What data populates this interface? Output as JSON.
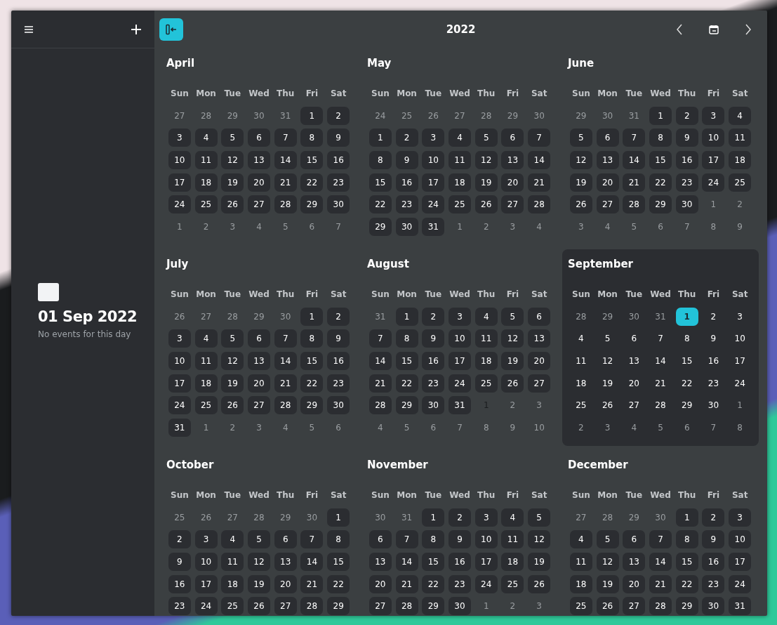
{
  "sidebar": {
    "date": "01 Sep 2022",
    "caption": "No events for this day"
  },
  "header": {
    "title": "2022"
  },
  "months": [
    {
      "name": "April",
      "current": false,
      "weekdays": [
        "Sun",
        "Mon",
        "Tue",
        "Wed",
        "Thu",
        "Fri",
        "Sat"
      ],
      "weeks": [
        [
          {
            "n": "27",
            "in": false,
            "selected": false
          },
          {
            "n": "28",
            "in": false,
            "selected": false
          },
          {
            "n": "29",
            "in": false,
            "selected": false
          },
          {
            "n": "30",
            "in": false,
            "selected": false
          },
          {
            "n": "31",
            "in": false,
            "selected": false
          },
          {
            "n": "1",
            "in": true,
            "selected": false
          },
          {
            "n": "2",
            "in": true,
            "selected": false
          }
        ],
        [
          {
            "n": "3",
            "in": true,
            "selected": false
          },
          {
            "n": "4",
            "in": true,
            "selected": false
          },
          {
            "n": "5",
            "in": true,
            "selected": false
          },
          {
            "n": "6",
            "in": true,
            "selected": false
          },
          {
            "n": "7",
            "in": true,
            "selected": false
          },
          {
            "n": "8",
            "in": true,
            "selected": false
          },
          {
            "n": "9",
            "in": true,
            "selected": false
          }
        ],
        [
          {
            "n": "10",
            "in": true,
            "selected": false
          },
          {
            "n": "11",
            "in": true,
            "selected": false
          },
          {
            "n": "12",
            "in": true,
            "selected": false
          },
          {
            "n": "13",
            "in": true,
            "selected": false
          },
          {
            "n": "14",
            "in": true,
            "selected": false
          },
          {
            "n": "15",
            "in": true,
            "selected": false
          },
          {
            "n": "16",
            "in": true,
            "selected": false
          }
        ],
        [
          {
            "n": "17",
            "in": true,
            "selected": false
          },
          {
            "n": "18",
            "in": true,
            "selected": false
          },
          {
            "n": "19",
            "in": true,
            "selected": false
          },
          {
            "n": "20",
            "in": true,
            "selected": false
          },
          {
            "n": "21",
            "in": true,
            "selected": false
          },
          {
            "n": "22",
            "in": true,
            "selected": false
          },
          {
            "n": "23",
            "in": true,
            "selected": false
          }
        ],
        [
          {
            "n": "24",
            "in": true,
            "selected": false
          },
          {
            "n": "25",
            "in": true,
            "selected": false
          },
          {
            "n": "26",
            "in": true,
            "selected": false
          },
          {
            "n": "27",
            "in": true,
            "selected": false
          },
          {
            "n": "28",
            "in": true,
            "selected": false
          },
          {
            "n": "29",
            "in": true,
            "selected": false
          },
          {
            "n": "30",
            "in": true,
            "selected": false
          }
        ],
        [
          {
            "n": "1",
            "in": false,
            "selected": false
          },
          {
            "n": "2",
            "in": false,
            "selected": false
          },
          {
            "n": "3",
            "in": false,
            "selected": false
          },
          {
            "n": "4",
            "in": false,
            "selected": false
          },
          {
            "n": "5",
            "in": false,
            "selected": false
          },
          {
            "n": "6",
            "in": false,
            "selected": false
          },
          {
            "n": "7",
            "in": false,
            "selected": false
          }
        ]
      ]
    },
    {
      "name": "May",
      "current": false,
      "weekdays": [
        "Sun",
        "Mon",
        "Tue",
        "Wed",
        "Thu",
        "Fri",
        "Sat"
      ],
      "weeks": [
        [
          {
            "n": "24",
            "in": false,
            "selected": false
          },
          {
            "n": "25",
            "in": false,
            "selected": false
          },
          {
            "n": "26",
            "in": false,
            "selected": false
          },
          {
            "n": "27",
            "in": false,
            "selected": false
          },
          {
            "n": "28",
            "in": false,
            "selected": false
          },
          {
            "n": "29",
            "in": false,
            "selected": false
          },
          {
            "n": "30",
            "in": false,
            "selected": false
          }
        ],
        [
          {
            "n": "1",
            "in": true,
            "selected": false
          },
          {
            "n": "2",
            "in": true,
            "selected": false
          },
          {
            "n": "3",
            "in": true,
            "selected": false
          },
          {
            "n": "4",
            "in": true,
            "selected": false
          },
          {
            "n": "5",
            "in": true,
            "selected": false
          },
          {
            "n": "6",
            "in": true,
            "selected": false
          },
          {
            "n": "7",
            "in": true,
            "selected": false
          }
        ],
        [
          {
            "n": "8",
            "in": true,
            "selected": false
          },
          {
            "n": "9",
            "in": true,
            "selected": false
          },
          {
            "n": "10",
            "in": true,
            "selected": false
          },
          {
            "n": "11",
            "in": true,
            "selected": false
          },
          {
            "n": "12",
            "in": true,
            "selected": false
          },
          {
            "n": "13",
            "in": true,
            "selected": false
          },
          {
            "n": "14",
            "in": true,
            "selected": false
          }
        ],
        [
          {
            "n": "15",
            "in": true,
            "selected": false
          },
          {
            "n": "16",
            "in": true,
            "selected": false
          },
          {
            "n": "17",
            "in": true,
            "selected": false
          },
          {
            "n": "18",
            "in": true,
            "selected": false
          },
          {
            "n": "19",
            "in": true,
            "selected": false
          },
          {
            "n": "20",
            "in": true,
            "selected": false
          },
          {
            "n": "21",
            "in": true,
            "selected": false
          }
        ],
        [
          {
            "n": "22",
            "in": true,
            "selected": false
          },
          {
            "n": "23",
            "in": true,
            "selected": false
          },
          {
            "n": "24",
            "in": true,
            "selected": false
          },
          {
            "n": "25",
            "in": true,
            "selected": false
          },
          {
            "n": "26",
            "in": true,
            "selected": false
          },
          {
            "n": "27",
            "in": true,
            "selected": false
          },
          {
            "n": "28",
            "in": true,
            "selected": false
          }
        ],
        [
          {
            "n": "29",
            "in": true,
            "selected": false
          },
          {
            "n": "30",
            "in": true,
            "selected": false
          },
          {
            "n": "31",
            "in": true,
            "selected": false
          },
          {
            "n": "1",
            "in": false,
            "selected": false
          },
          {
            "n": "2",
            "in": false,
            "selected": false
          },
          {
            "n": "3",
            "in": false,
            "selected": false
          },
          {
            "n": "4",
            "in": false,
            "selected": false
          }
        ]
      ]
    },
    {
      "name": "June",
      "current": false,
      "weekdays": [
        "Sun",
        "Mon",
        "Tue",
        "Wed",
        "Thu",
        "Fri",
        "Sat"
      ],
      "weeks": [
        [
          {
            "n": "29",
            "in": false,
            "selected": false
          },
          {
            "n": "30",
            "in": false,
            "selected": false
          },
          {
            "n": "31",
            "in": false,
            "selected": false
          },
          {
            "n": "1",
            "in": true,
            "selected": false
          },
          {
            "n": "2",
            "in": true,
            "selected": false
          },
          {
            "n": "3",
            "in": true,
            "selected": false
          },
          {
            "n": "4",
            "in": true,
            "selected": false
          }
        ],
        [
          {
            "n": "5",
            "in": true,
            "selected": false
          },
          {
            "n": "6",
            "in": true,
            "selected": false
          },
          {
            "n": "7",
            "in": true,
            "selected": false
          },
          {
            "n": "8",
            "in": true,
            "selected": false
          },
          {
            "n": "9",
            "in": true,
            "selected": false
          },
          {
            "n": "10",
            "in": true,
            "selected": false
          },
          {
            "n": "11",
            "in": true,
            "selected": false
          }
        ],
        [
          {
            "n": "12",
            "in": true,
            "selected": false
          },
          {
            "n": "13",
            "in": true,
            "selected": false
          },
          {
            "n": "14",
            "in": true,
            "selected": false
          },
          {
            "n": "15",
            "in": true,
            "selected": false
          },
          {
            "n": "16",
            "in": true,
            "selected": false
          },
          {
            "n": "17",
            "in": true,
            "selected": false
          },
          {
            "n": "18",
            "in": true,
            "selected": false
          }
        ],
        [
          {
            "n": "19",
            "in": true,
            "selected": false
          },
          {
            "n": "20",
            "in": true,
            "selected": false
          },
          {
            "n": "21",
            "in": true,
            "selected": false
          },
          {
            "n": "22",
            "in": true,
            "selected": false
          },
          {
            "n": "23",
            "in": true,
            "selected": false
          },
          {
            "n": "24",
            "in": true,
            "selected": false
          },
          {
            "n": "25",
            "in": true,
            "selected": false
          }
        ],
        [
          {
            "n": "26",
            "in": true,
            "selected": false
          },
          {
            "n": "27",
            "in": true,
            "selected": false
          },
          {
            "n": "28",
            "in": true,
            "selected": false
          },
          {
            "n": "29",
            "in": true,
            "selected": false
          },
          {
            "n": "30",
            "in": true,
            "selected": false
          },
          {
            "n": "1",
            "in": false,
            "selected": false
          },
          {
            "n": "2",
            "in": false,
            "selected": false
          }
        ],
        [
          {
            "n": "3",
            "in": false,
            "selected": false
          },
          {
            "n": "4",
            "in": false,
            "selected": false
          },
          {
            "n": "5",
            "in": false,
            "selected": false
          },
          {
            "n": "6",
            "in": false,
            "selected": false
          },
          {
            "n": "7",
            "in": false,
            "selected": false
          },
          {
            "n": "8",
            "in": false,
            "selected": false
          },
          {
            "n": "9",
            "in": false,
            "selected": false
          }
        ]
      ]
    },
    {
      "name": "July",
      "current": false,
      "weekdays": [
        "Sun",
        "Mon",
        "Tue",
        "Wed",
        "Thu",
        "Fri",
        "Sat"
      ],
      "weeks": [
        [
          {
            "n": "26",
            "in": false,
            "selected": false
          },
          {
            "n": "27",
            "in": false,
            "selected": false
          },
          {
            "n": "28",
            "in": false,
            "selected": false
          },
          {
            "n": "29",
            "in": false,
            "selected": false
          },
          {
            "n": "30",
            "in": false,
            "selected": false
          },
          {
            "n": "1",
            "in": true,
            "selected": false
          },
          {
            "n": "2",
            "in": true,
            "selected": false
          }
        ],
        [
          {
            "n": "3",
            "in": true,
            "selected": false
          },
          {
            "n": "4",
            "in": true,
            "selected": false
          },
          {
            "n": "5",
            "in": true,
            "selected": false
          },
          {
            "n": "6",
            "in": true,
            "selected": false
          },
          {
            "n": "7",
            "in": true,
            "selected": false
          },
          {
            "n": "8",
            "in": true,
            "selected": false
          },
          {
            "n": "9",
            "in": true,
            "selected": false
          }
        ],
        [
          {
            "n": "10",
            "in": true,
            "selected": false
          },
          {
            "n": "11",
            "in": true,
            "selected": false
          },
          {
            "n": "12",
            "in": true,
            "selected": false
          },
          {
            "n": "13",
            "in": true,
            "selected": false
          },
          {
            "n": "14",
            "in": true,
            "selected": false
          },
          {
            "n": "15",
            "in": true,
            "selected": false
          },
          {
            "n": "16",
            "in": true,
            "selected": false
          }
        ],
        [
          {
            "n": "17",
            "in": true,
            "selected": false
          },
          {
            "n": "18",
            "in": true,
            "selected": false
          },
          {
            "n": "19",
            "in": true,
            "selected": false
          },
          {
            "n": "20",
            "in": true,
            "selected": false
          },
          {
            "n": "21",
            "in": true,
            "selected": false
          },
          {
            "n": "22",
            "in": true,
            "selected": false
          },
          {
            "n": "23",
            "in": true,
            "selected": false
          }
        ],
        [
          {
            "n": "24",
            "in": true,
            "selected": false
          },
          {
            "n": "25",
            "in": true,
            "selected": false
          },
          {
            "n": "26",
            "in": true,
            "selected": false
          },
          {
            "n": "27",
            "in": true,
            "selected": false
          },
          {
            "n": "28",
            "in": true,
            "selected": false
          },
          {
            "n": "29",
            "in": true,
            "selected": false
          },
          {
            "n": "30",
            "in": true,
            "selected": false
          }
        ],
        [
          {
            "n": "31",
            "in": true,
            "selected": false
          },
          {
            "n": "1",
            "in": false,
            "selected": false
          },
          {
            "n": "2",
            "in": false,
            "selected": false
          },
          {
            "n": "3",
            "in": false,
            "selected": false
          },
          {
            "n": "4",
            "in": false,
            "selected": false
          },
          {
            "n": "5",
            "in": false,
            "selected": false
          },
          {
            "n": "6",
            "in": false,
            "selected": false
          }
        ]
      ]
    },
    {
      "name": "August",
      "current": false,
      "weekdays": [
        "Sun",
        "Mon",
        "Tue",
        "Wed",
        "Thu",
        "Fri",
        "Sat"
      ],
      "weeks": [
        [
          {
            "n": "31",
            "in": false,
            "selected": false
          },
          {
            "n": "1",
            "in": true,
            "selected": false
          },
          {
            "n": "2",
            "in": true,
            "selected": false
          },
          {
            "n": "3",
            "in": true,
            "selected": false
          },
          {
            "n": "4",
            "in": true,
            "selected": false
          },
          {
            "n": "5",
            "in": true,
            "selected": false
          },
          {
            "n": "6",
            "in": true,
            "selected": false
          }
        ],
        [
          {
            "n": "7",
            "in": true,
            "selected": false
          },
          {
            "n": "8",
            "in": true,
            "selected": false
          },
          {
            "n": "9",
            "in": true,
            "selected": false
          },
          {
            "n": "10",
            "in": true,
            "selected": false
          },
          {
            "n": "11",
            "in": true,
            "selected": false
          },
          {
            "n": "12",
            "in": true,
            "selected": false
          },
          {
            "n": "13",
            "in": true,
            "selected": false
          }
        ],
        [
          {
            "n": "14",
            "in": true,
            "selected": false
          },
          {
            "n": "15",
            "in": true,
            "selected": false
          },
          {
            "n": "16",
            "in": true,
            "selected": false
          },
          {
            "n": "17",
            "in": true,
            "selected": false
          },
          {
            "n": "18",
            "in": true,
            "selected": false
          },
          {
            "n": "19",
            "in": true,
            "selected": false
          },
          {
            "n": "20",
            "in": true,
            "selected": false
          }
        ],
        [
          {
            "n": "21",
            "in": true,
            "selected": false
          },
          {
            "n": "22",
            "in": true,
            "selected": false
          },
          {
            "n": "23",
            "in": true,
            "selected": false
          },
          {
            "n": "24",
            "in": true,
            "selected": false
          },
          {
            "n": "25",
            "in": true,
            "selected": false
          },
          {
            "n": "26",
            "in": true,
            "selected": false
          },
          {
            "n": "27",
            "in": true,
            "selected": false
          }
        ],
        [
          {
            "n": "28",
            "in": true,
            "selected": false
          },
          {
            "n": "29",
            "in": true,
            "selected": false
          },
          {
            "n": "30",
            "in": true,
            "selected": false
          },
          {
            "n": "31",
            "in": true,
            "selected": false
          },
          {
            "n": "1",
            "in": false,
            "selected": true
          },
          {
            "n": "2",
            "in": false,
            "selected": false
          },
          {
            "n": "3",
            "in": false,
            "selected": false
          }
        ],
        [
          {
            "n": "4",
            "in": false,
            "selected": false
          },
          {
            "n": "5",
            "in": false,
            "selected": false
          },
          {
            "n": "6",
            "in": false,
            "selected": false
          },
          {
            "n": "7",
            "in": false,
            "selected": false
          },
          {
            "n": "8",
            "in": false,
            "selected": false
          },
          {
            "n": "9",
            "in": false,
            "selected": false
          },
          {
            "n": "10",
            "in": false,
            "selected": false
          }
        ]
      ]
    },
    {
      "name": "September",
      "current": true,
      "weekdays": [
        "Sun",
        "Mon",
        "Tue",
        "Wed",
        "Thu",
        "Fri",
        "Sat"
      ],
      "weeks": [
        [
          {
            "n": "28",
            "in": false,
            "selected": false
          },
          {
            "n": "29",
            "in": false,
            "selected": false
          },
          {
            "n": "30",
            "in": false,
            "selected": false
          },
          {
            "n": "31",
            "in": false,
            "selected": false
          },
          {
            "n": "1",
            "in": true,
            "selected": true
          },
          {
            "n": "2",
            "in": true,
            "selected": false
          },
          {
            "n": "3",
            "in": true,
            "selected": false
          }
        ],
        [
          {
            "n": "4",
            "in": true,
            "selected": false
          },
          {
            "n": "5",
            "in": true,
            "selected": false
          },
          {
            "n": "6",
            "in": true,
            "selected": false
          },
          {
            "n": "7",
            "in": true,
            "selected": false
          },
          {
            "n": "8",
            "in": true,
            "selected": false
          },
          {
            "n": "9",
            "in": true,
            "selected": false
          },
          {
            "n": "10",
            "in": true,
            "selected": false
          }
        ],
        [
          {
            "n": "11",
            "in": true,
            "selected": false
          },
          {
            "n": "12",
            "in": true,
            "selected": false
          },
          {
            "n": "13",
            "in": true,
            "selected": false
          },
          {
            "n": "14",
            "in": true,
            "selected": false
          },
          {
            "n": "15",
            "in": true,
            "selected": false
          },
          {
            "n": "16",
            "in": true,
            "selected": false
          },
          {
            "n": "17",
            "in": true,
            "selected": false
          }
        ],
        [
          {
            "n": "18",
            "in": true,
            "selected": false
          },
          {
            "n": "19",
            "in": true,
            "selected": false
          },
          {
            "n": "20",
            "in": true,
            "selected": false
          },
          {
            "n": "21",
            "in": true,
            "selected": false
          },
          {
            "n": "22",
            "in": true,
            "selected": false
          },
          {
            "n": "23",
            "in": true,
            "selected": false
          },
          {
            "n": "24",
            "in": true,
            "selected": false
          }
        ],
        [
          {
            "n": "25",
            "in": true,
            "selected": false
          },
          {
            "n": "26",
            "in": true,
            "selected": false
          },
          {
            "n": "27",
            "in": true,
            "selected": false
          },
          {
            "n": "28",
            "in": true,
            "selected": false
          },
          {
            "n": "29",
            "in": true,
            "selected": false
          },
          {
            "n": "30",
            "in": true,
            "selected": false
          },
          {
            "n": "1",
            "in": false,
            "selected": false
          }
        ],
        [
          {
            "n": "2",
            "in": false,
            "selected": false
          },
          {
            "n": "3",
            "in": false,
            "selected": false
          },
          {
            "n": "4",
            "in": false,
            "selected": false
          },
          {
            "n": "5",
            "in": false,
            "selected": false
          },
          {
            "n": "6",
            "in": false,
            "selected": false
          },
          {
            "n": "7",
            "in": false,
            "selected": false
          },
          {
            "n": "8",
            "in": false,
            "selected": false
          }
        ]
      ]
    },
    {
      "name": "October",
      "current": false,
      "weekdays": [
        "Sun",
        "Mon",
        "Tue",
        "Wed",
        "Thu",
        "Fri",
        "Sat"
      ],
      "weeks": [
        [
          {
            "n": "25",
            "in": false,
            "selected": false
          },
          {
            "n": "26",
            "in": false,
            "selected": false
          },
          {
            "n": "27",
            "in": false,
            "selected": false
          },
          {
            "n": "28",
            "in": false,
            "selected": false
          },
          {
            "n": "29",
            "in": false,
            "selected": false
          },
          {
            "n": "30",
            "in": false,
            "selected": false
          },
          {
            "n": "1",
            "in": true,
            "selected": false
          }
        ],
        [
          {
            "n": "2",
            "in": true,
            "selected": false
          },
          {
            "n": "3",
            "in": true,
            "selected": false
          },
          {
            "n": "4",
            "in": true,
            "selected": false
          },
          {
            "n": "5",
            "in": true,
            "selected": false
          },
          {
            "n": "6",
            "in": true,
            "selected": false
          },
          {
            "n": "7",
            "in": true,
            "selected": false
          },
          {
            "n": "8",
            "in": true,
            "selected": false
          }
        ],
        [
          {
            "n": "9",
            "in": true,
            "selected": false
          },
          {
            "n": "10",
            "in": true,
            "selected": false
          },
          {
            "n": "11",
            "in": true,
            "selected": false
          },
          {
            "n": "12",
            "in": true,
            "selected": false
          },
          {
            "n": "13",
            "in": true,
            "selected": false
          },
          {
            "n": "14",
            "in": true,
            "selected": false
          },
          {
            "n": "15",
            "in": true,
            "selected": false
          }
        ],
        [
          {
            "n": "16",
            "in": true,
            "selected": false
          },
          {
            "n": "17",
            "in": true,
            "selected": false
          },
          {
            "n": "18",
            "in": true,
            "selected": false
          },
          {
            "n": "19",
            "in": true,
            "selected": false
          },
          {
            "n": "20",
            "in": true,
            "selected": false
          },
          {
            "n": "21",
            "in": true,
            "selected": false
          },
          {
            "n": "22",
            "in": true,
            "selected": false
          }
        ],
        [
          {
            "n": "23",
            "in": true,
            "selected": false
          },
          {
            "n": "24",
            "in": true,
            "selected": false
          },
          {
            "n": "25",
            "in": true,
            "selected": false
          },
          {
            "n": "26",
            "in": true,
            "selected": false
          },
          {
            "n": "27",
            "in": true,
            "selected": false
          },
          {
            "n": "28",
            "in": true,
            "selected": false
          },
          {
            "n": "29",
            "in": true,
            "selected": false
          }
        ]
      ]
    },
    {
      "name": "November",
      "current": false,
      "weekdays": [
        "Sun",
        "Mon",
        "Tue",
        "Wed",
        "Thu",
        "Fri",
        "Sat"
      ],
      "weeks": [
        [
          {
            "n": "30",
            "in": false,
            "selected": false
          },
          {
            "n": "31",
            "in": false,
            "selected": false
          },
          {
            "n": "1",
            "in": true,
            "selected": false
          },
          {
            "n": "2",
            "in": true,
            "selected": false
          },
          {
            "n": "3",
            "in": true,
            "selected": false
          },
          {
            "n": "4",
            "in": true,
            "selected": false
          },
          {
            "n": "5",
            "in": true,
            "selected": false
          }
        ],
        [
          {
            "n": "6",
            "in": true,
            "selected": false
          },
          {
            "n": "7",
            "in": true,
            "selected": false
          },
          {
            "n": "8",
            "in": true,
            "selected": false
          },
          {
            "n": "9",
            "in": true,
            "selected": false
          },
          {
            "n": "10",
            "in": true,
            "selected": false
          },
          {
            "n": "11",
            "in": true,
            "selected": false
          },
          {
            "n": "12",
            "in": true,
            "selected": false
          }
        ],
        [
          {
            "n": "13",
            "in": true,
            "selected": false
          },
          {
            "n": "14",
            "in": true,
            "selected": false
          },
          {
            "n": "15",
            "in": true,
            "selected": false
          },
          {
            "n": "16",
            "in": true,
            "selected": false
          },
          {
            "n": "17",
            "in": true,
            "selected": false
          },
          {
            "n": "18",
            "in": true,
            "selected": false
          },
          {
            "n": "19",
            "in": true,
            "selected": false
          }
        ],
        [
          {
            "n": "20",
            "in": true,
            "selected": false
          },
          {
            "n": "21",
            "in": true,
            "selected": false
          },
          {
            "n": "22",
            "in": true,
            "selected": false
          },
          {
            "n": "23",
            "in": true,
            "selected": false
          },
          {
            "n": "24",
            "in": true,
            "selected": false
          },
          {
            "n": "25",
            "in": true,
            "selected": false
          },
          {
            "n": "26",
            "in": true,
            "selected": false
          }
        ],
        [
          {
            "n": "27",
            "in": true,
            "selected": false
          },
          {
            "n": "28",
            "in": true,
            "selected": false
          },
          {
            "n": "29",
            "in": true,
            "selected": false
          },
          {
            "n": "30",
            "in": true,
            "selected": false
          },
          {
            "n": "1",
            "in": false,
            "selected": false
          },
          {
            "n": "2",
            "in": false,
            "selected": false
          },
          {
            "n": "3",
            "in": false,
            "selected": false
          }
        ]
      ]
    },
    {
      "name": "December",
      "current": false,
      "weekdays": [
        "Sun",
        "Mon",
        "Tue",
        "Wed",
        "Thu",
        "Fri",
        "Sat"
      ],
      "weeks": [
        [
          {
            "n": "27",
            "in": false,
            "selected": false
          },
          {
            "n": "28",
            "in": false,
            "selected": false
          },
          {
            "n": "29",
            "in": false,
            "selected": false
          },
          {
            "n": "30",
            "in": false,
            "selected": false
          },
          {
            "n": "1",
            "in": true,
            "selected": false
          },
          {
            "n": "2",
            "in": true,
            "selected": false
          },
          {
            "n": "3",
            "in": true,
            "selected": false
          }
        ],
        [
          {
            "n": "4",
            "in": true,
            "selected": false
          },
          {
            "n": "5",
            "in": true,
            "selected": false
          },
          {
            "n": "6",
            "in": true,
            "selected": false
          },
          {
            "n": "7",
            "in": true,
            "selected": false
          },
          {
            "n": "8",
            "in": true,
            "selected": false
          },
          {
            "n": "9",
            "in": true,
            "selected": false
          },
          {
            "n": "10",
            "in": true,
            "selected": false
          }
        ],
        [
          {
            "n": "11",
            "in": true,
            "selected": false
          },
          {
            "n": "12",
            "in": true,
            "selected": false
          },
          {
            "n": "13",
            "in": true,
            "selected": false
          },
          {
            "n": "14",
            "in": true,
            "selected": false
          },
          {
            "n": "15",
            "in": true,
            "selected": false
          },
          {
            "n": "16",
            "in": true,
            "selected": false
          },
          {
            "n": "17",
            "in": true,
            "selected": false
          }
        ],
        [
          {
            "n": "18",
            "in": true,
            "selected": false
          },
          {
            "n": "19",
            "in": true,
            "selected": false
          },
          {
            "n": "20",
            "in": true,
            "selected": false
          },
          {
            "n": "21",
            "in": true,
            "selected": false
          },
          {
            "n": "22",
            "in": true,
            "selected": false
          },
          {
            "n": "23",
            "in": true,
            "selected": false
          },
          {
            "n": "24",
            "in": true,
            "selected": false
          }
        ],
        [
          {
            "n": "25",
            "in": true,
            "selected": false
          },
          {
            "n": "26",
            "in": true,
            "selected": false
          },
          {
            "n": "27",
            "in": true,
            "selected": false
          },
          {
            "n": "28",
            "in": true,
            "selected": false
          },
          {
            "n": "29",
            "in": true,
            "selected": false
          },
          {
            "n": "30",
            "in": true,
            "selected": false
          },
          {
            "n": "31",
            "in": true,
            "selected": false
          }
        ]
      ]
    }
  ]
}
